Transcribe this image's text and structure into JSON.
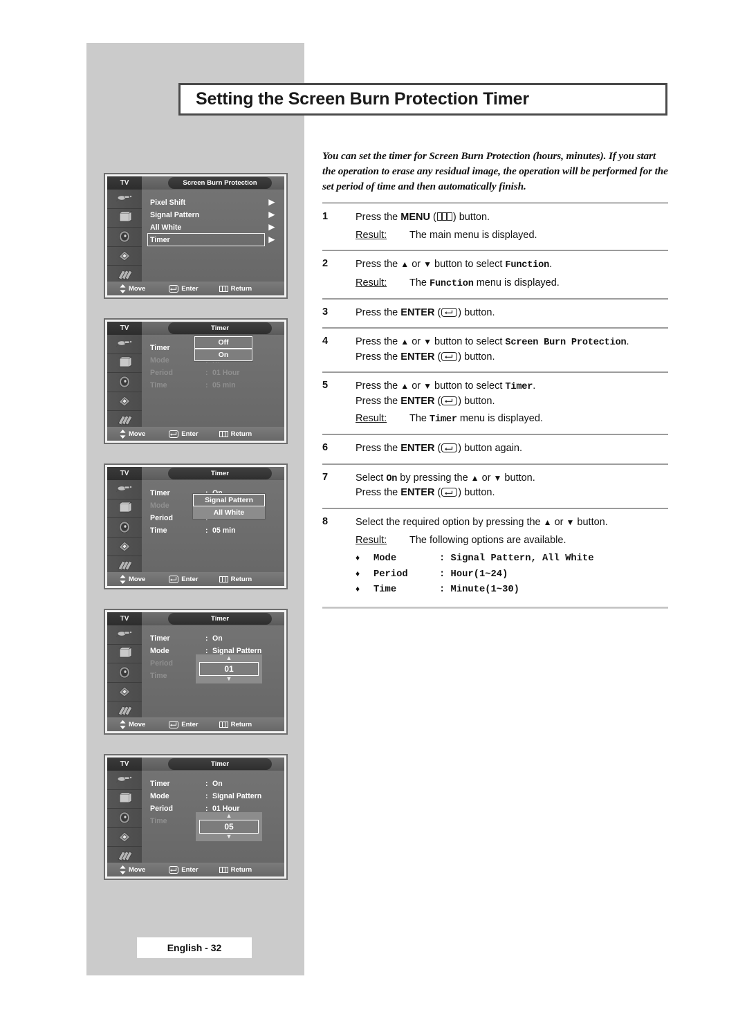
{
  "page": {
    "title": "Setting the Screen Burn Protection Timer",
    "footer": "English - 32",
    "intro": "You can set the timer for Screen Burn Protection (hours, minutes). If you start the operation to erase any residual image, the operation will be performed for the set period of time and then automatically finish."
  },
  "steps": [
    {
      "num": "1",
      "text_before": "Press the ",
      "bold": "MENU",
      "icon": "menu-icon",
      "text_after": ") button.",
      "result_label": "Result:",
      "result_text": "The main menu is displayed."
    },
    {
      "num": "2",
      "text_before": "Press the ",
      "up": "▲",
      "or": " or ",
      "down": "▼",
      "text_mid": " button to select ",
      "mono": "Function",
      "text_after": ".",
      "result_label": "Result:",
      "result_prefix": "The ",
      "result_mono": "Function",
      "result_suffix": " menu is displayed."
    },
    {
      "num": "3",
      "text_before": "Press the ",
      "bold": "ENTER",
      "icon": "enter-icon",
      "text_after": ") button."
    },
    {
      "num": "4",
      "line1_before": "Press the ",
      "up": "▲",
      "or": " or ",
      "down": "▼",
      "line1_mid": " button to select ",
      "line1_mono": "Screen Burn Protection",
      "line1_after": ".",
      "line2_before": "Press the ",
      "line2_bold": "ENTER",
      "line2_after": ") button."
    },
    {
      "num": "5",
      "line1_before": "Press the ",
      "up": "▲",
      "or": " or ",
      "down": "▼",
      "line1_mid": " button to select ",
      "line1_mono": "Timer",
      "line1_after": ".",
      "line2_before": "Press the ",
      "line2_bold": "ENTER",
      "line2_after": ") button.",
      "result_label": "Result:",
      "result_prefix": "The ",
      "result_mono": "Timer",
      "result_suffix": " menu is displayed."
    },
    {
      "num": "6",
      "text_before": "Press the ",
      "bold": "ENTER",
      "icon": "enter-icon",
      "text_after": ") button again."
    },
    {
      "num": "7",
      "line1_before": "Select ",
      "line1_mono": "On",
      "line1_mid": " by pressing the ",
      "up": "▲",
      "or": " or ",
      "down": "▼",
      "line1_after": " button.",
      "line2_before": "Press the ",
      "line2_bold": "ENTER",
      "line2_after": ") button."
    },
    {
      "num": "8",
      "line1_before": "Select the required option by pressing the ",
      "up": "▲",
      "or": " or ",
      "down": "▼",
      "line1_after": " button.",
      "result_label": "Result:",
      "result_text": "The following options are available.",
      "options": [
        {
          "bullet": "♦",
          "key": "Mode",
          "value": ": Signal Pattern, All White"
        },
        {
          "bullet": "♦",
          "key": "Period",
          "value": ": Hour(1~24)"
        },
        {
          "bullet": "♦",
          "key": "Time",
          "value": ": Minute(1~30)"
        }
      ]
    }
  ],
  "osd_common": {
    "tv_label": "TV",
    "bottom": {
      "move": "Move",
      "enter": "Enter",
      "return": "Return"
    }
  },
  "osd_panels": [
    {
      "id": "screen-burn-protection-menu",
      "tab_title": "Screen Burn Protection",
      "rows": [
        {
          "label": "Pixel Shift",
          "arrow": "▶",
          "selected": false
        },
        {
          "label": "Signal Pattern",
          "arrow": "▶",
          "selected": false
        },
        {
          "label": "All White",
          "arrow": "▶",
          "selected": false
        },
        {
          "label": "Timer",
          "arrow": "▶",
          "selected": true
        }
      ]
    },
    {
      "id": "timer-menu-timer-dropdown",
      "tab_title": "Timer",
      "rows": [
        {
          "label": "Timer",
          "colon": ":",
          "value": "",
          "dim": false
        },
        {
          "label": "Mode",
          "colon": ":",
          "value": "rn",
          "dim": true
        },
        {
          "label": "Period",
          "colon": ":",
          "value": "01 Hour",
          "dim": true
        },
        {
          "label": "Time",
          "colon": ":",
          "value": "05 min",
          "dim": true
        }
      ],
      "dropdown": {
        "options": [
          "Off",
          "On"
        ],
        "selected_index": 1
      }
    },
    {
      "id": "timer-menu-mode-dropdown",
      "tab_title": "Timer",
      "rows": [
        {
          "label": "Timer",
          "colon": ":",
          "value": "On",
          "dim": false
        },
        {
          "label": "Mode",
          "colon": ":",
          "value": "",
          "dim": true
        },
        {
          "label": "Period",
          "colon": ":",
          "value": "",
          "dim": false
        },
        {
          "label": "Time",
          "colon": ":",
          "value": "05 min",
          "dim": false
        }
      ],
      "dropdown": {
        "options": [
          "Signal Pattern",
          "All White"
        ],
        "selected_index": 0
      }
    },
    {
      "id": "timer-menu-period-spinner",
      "tab_title": "Timer",
      "rows": [
        {
          "label": "Timer",
          "colon": ":",
          "value": "On",
          "dim": false
        },
        {
          "label": "Mode",
          "colon": ":",
          "value": "Signal Pattern",
          "dim": false
        },
        {
          "label": "Period",
          "colon": ":",
          "value": "",
          "dim": true
        },
        {
          "label": "Time",
          "colon": ":",
          "value": "",
          "dim": true
        }
      ],
      "spinner": {
        "up": "▲",
        "value": "01",
        "down": "▼"
      }
    },
    {
      "id": "timer-menu-time-spinner",
      "tab_title": "Timer",
      "rows": [
        {
          "label": "Timer",
          "colon": ":",
          "value": "On",
          "dim": false
        },
        {
          "label": "Mode",
          "colon": ":",
          "value": "Signal Pattern",
          "dim": false
        },
        {
          "label": "Period",
          "colon": ":",
          "value": "01 Hour",
          "dim": false
        },
        {
          "label": "Time",
          "colon": ":",
          "value": "",
          "dim": true
        }
      ],
      "spinner": {
        "up": "▲",
        "value": "05",
        "down": "▼"
      }
    }
  ],
  "colors": {
    "page_band": "#cbcbcb",
    "title_border": "#4a4a4a",
    "osd_body": "#6e6e6e",
    "osd_highlight": "#ffffff"
  }
}
